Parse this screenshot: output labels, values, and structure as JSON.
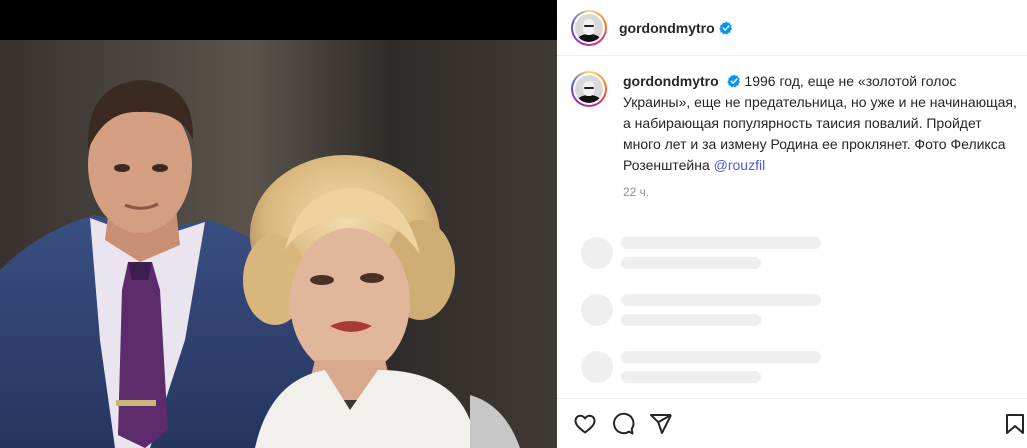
{
  "post": {
    "author": {
      "username": "gordondmytro",
      "verified": true
    },
    "caption": {
      "text": " 1996 год, еще не «золотой голос Украины», еще не предательница, но уже и не начинающая, а набирающая популярность таисия повалий. Пройдет много лет и за измену Родина ее проклянет. Фото Феликса Розенштейна ",
      "mention": "@rouzfil",
      "time_ago": "22 ч."
    },
    "comments_loading": 3,
    "actions": [
      {
        "name": "like",
        "icon": "heart-icon"
      },
      {
        "name": "comment",
        "icon": "comment-icon"
      },
      {
        "name": "share",
        "icon": "share-icon"
      },
      {
        "name": "save",
        "icon": "bookmark-icon"
      }
    ]
  },
  "colors": {
    "verified_badge": "#0095f6",
    "mention": "#4f5bd5",
    "text_primary": "#262626",
    "text_secondary": "#8e8e8e",
    "skeleton": "#efefef"
  }
}
